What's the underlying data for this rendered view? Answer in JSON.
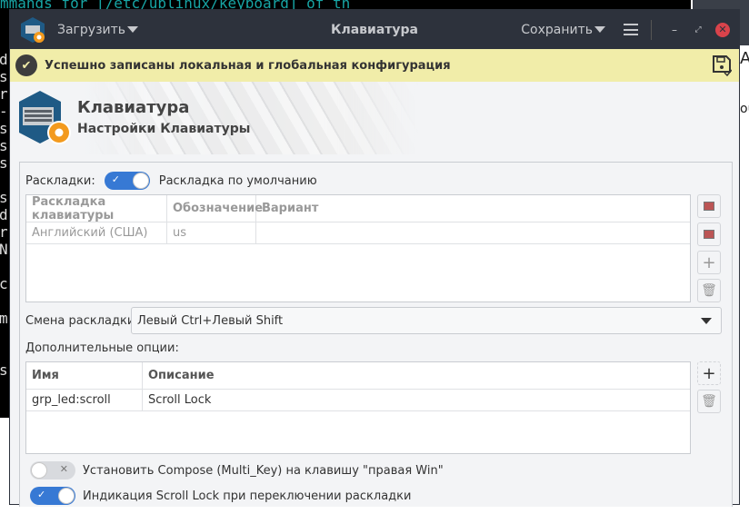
{
  "background": {
    "terminal_top": "mmands for [/etc/ublinux/keyboard] of th",
    "terminal_col": "d\ns\nr\n-\ns\ns\ns\n\ns\nd\nr\nN\n\nc\n\nm\n\n\ns",
    "right_window_text_1": "AE",
    "right_window_text_2": "ou"
  },
  "titlebar": {
    "load_label": "Загрузить",
    "title": "Клавиатура",
    "save_label": "Сохранить",
    "minimize": "–",
    "maximize": "⤢",
    "close": "✕"
  },
  "notice": {
    "text": "Успешно записаны локальная и глобальная конфигурация"
  },
  "banner": {
    "title": "Клавиатура",
    "subtitle": "Настройки Клавиатуры"
  },
  "layouts": {
    "label": "Раскладки:",
    "default_toggle_on": true,
    "default_label": "Раскладка по умолчанию",
    "columns": [
      "Раскладка клавиатуры",
      "Обозначение",
      "Вариант"
    ],
    "rows": [
      [
        "Английский (США)",
        "us",
        ""
      ]
    ]
  },
  "switch": {
    "label": "Смена раскладки:",
    "value": "Левый Ctrl+Левый Shift"
  },
  "options": {
    "label": "Дополнительные опции:",
    "columns": [
      "Имя",
      "Описание"
    ],
    "rows": [
      [
        "grp_led:scroll",
        "Scroll Lock"
      ]
    ]
  },
  "toggles": [
    {
      "label": "Установить Compose (Multi_Key) на клавишу \"правая Win\"",
      "on": false
    },
    {
      "label": "Индикация Scroll Lock при переключении раскладки",
      "on": true
    }
  ],
  "colors": {
    "accent": "#3779d4",
    "titlebar": "#2d323c",
    "notice": "#f1eda9",
    "close": "#d9434b"
  }
}
